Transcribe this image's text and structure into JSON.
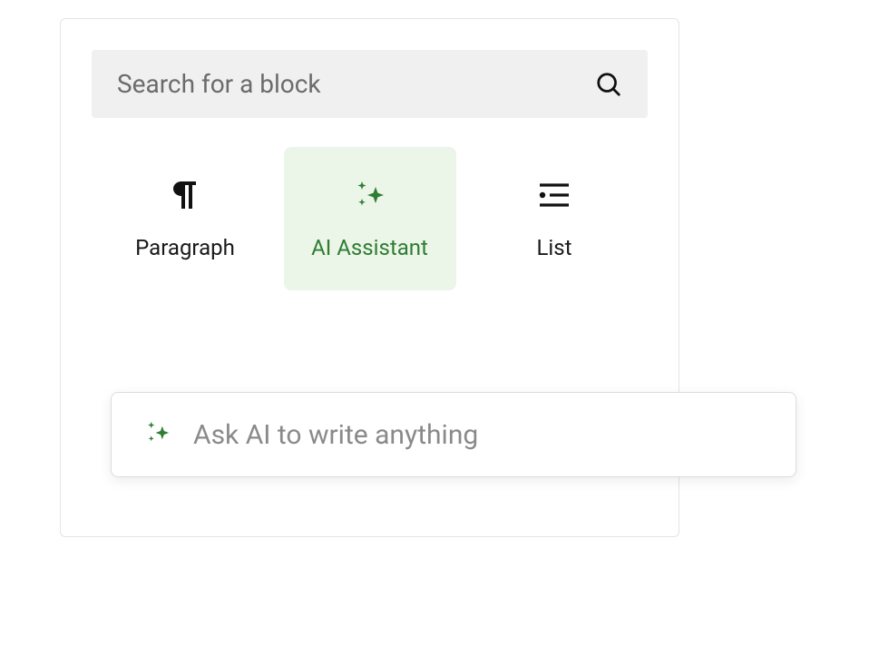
{
  "search": {
    "placeholder": "Search for a block"
  },
  "blocks": {
    "paragraph": {
      "label": "Paragraph"
    },
    "ai_assistant": {
      "label": "AI Assistant"
    },
    "list": {
      "label": "List"
    }
  },
  "ai_input": {
    "placeholder": "Ask AI to write anything"
  },
  "colors": {
    "accent_green": "#2f7d32",
    "selected_bg": "#ebf5e8"
  }
}
